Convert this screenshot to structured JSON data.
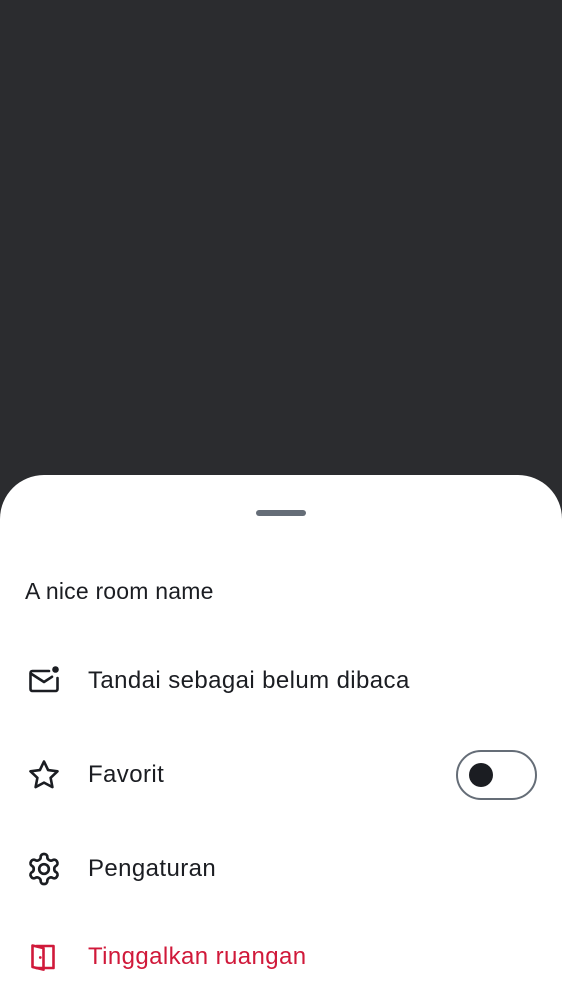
{
  "colors": {
    "scrim": "#2b2c2f",
    "sheet": "#ffffff",
    "text_primary": "#1b1d22",
    "handle": "#656d77",
    "critical": "#d0193a"
  },
  "sheet": {
    "title": "A nice room name",
    "items": [
      {
        "label": "Tandai sebagai belum dibaca",
        "icon": "mark-unread-icon"
      },
      {
        "label": "Favorit",
        "icon": "star-outline-icon",
        "toggle": {
          "on": false
        }
      },
      {
        "label": "Pengaturan",
        "icon": "gear-icon"
      },
      {
        "label": "Tinggalkan ruangan",
        "icon": "leave-room-icon",
        "style": "critical"
      }
    ]
  }
}
